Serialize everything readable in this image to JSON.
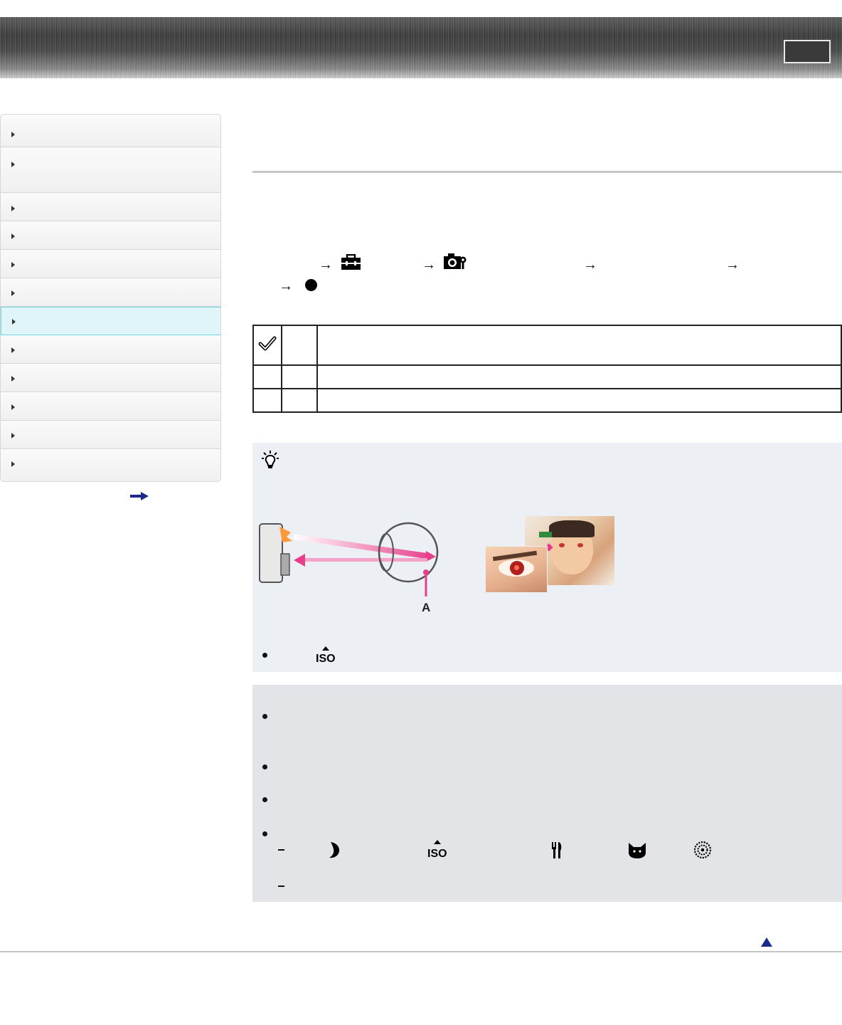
{
  "header": {
    "title": "",
    "button_label": ""
  },
  "sidebar": {
    "items": [
      {
        "label": "",
        "active": false
      },
      {
        "label": "",
        "active": false
      },
      {
        "label": "",
        "active": false
      },
      {
        "label": "",
        "active": false
      },
      {
        "label": "",
        "active": false
      },
      {
        "label": "",
        "active": false
      },
      {
        "label": "",
        "active": true
      },
      {
        "label": "",
        "active": false
      },
      {
        "label": "",
        "active": false
      },
      {
        "label": "",
        "active": false
      },
      {
        "label": "",
        "active": false
      },
      {
        "label": "",
        "active": false
      }
    ]
  },
  "main": {
    "page_title": "",
    "menu_path_icons": [
      "toolbox-icon",
      "camera-settings-icon",
      "dot-icon"
    ],
    "options": [
      {
        "icon": "checkmark-icon",
        "name": "",
        "description": ""
      },
      {
        "icon": "",
        "name": "",
        "description": ""
      },
      {
        "icon": "",
        "name": "",
        "description": ""
      }
    ],
    "hint": {
      "icon": "lightbulb-icon",
      "diagram_label": "A",
      "bullet_icon": "high-sensitivity-iso-icon"
    },
    "notes": {
      "bullet_count": 4,
      "scene_icons": [
        "night-moon-icon",
        "high-sensitivity-iso-icon",
        "gourmet-fork-knife-icon",
        "pet-cat-icon",
        "fireworks-icon"
      ]
    }
  },
  "colors": {
    "accent_active": "#dff5f8",
    "accent_border": "#6fd3e3",
    "link_arrow": "#1a2a8a",
    "diagram_pink": "#e83e8c"
  }
}
